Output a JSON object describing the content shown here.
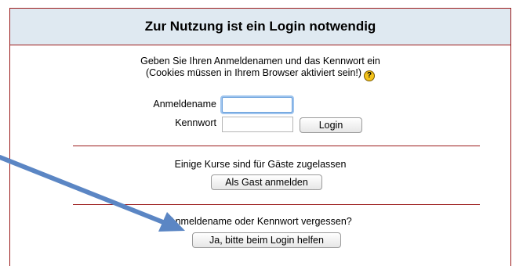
{
  "header": {
    "title": "Zur Nutzung ist ein Login notwendig"
  },
  "intro": {
    "line1": "Geben Sie Ihren Anmeldenamen und das Kennwort ein",
    "line2": "(Cookies müssen in Ihrem Browser aktiviert sein!)",
    "help_icon_glyph": "?"
  },
  "login": {
    "username_label": "Anmeldename",
    "username_value": "",
    "password_label": "Kennwort",
    "password_value": "",
    "login_button": "Login"
  },
  "guest": {
    "text": "Einige Kurse sind für Gäste zugelassen",
    "button": "Als Gast anmelden"
  },
  "forgot": {
    "text": "Anmeldename oder Kennwort vergessen?",
    "button": "Ja, bitte beim Login helfen"
  },
  "colors": {
    "border": "#9b1a1a",
    "header_bg": "#dfe9f1",
    "arrow": "#5b86c4"
  },
  "icons": [
    "help-icon",
    "annotation-arrow"
  ]
}
